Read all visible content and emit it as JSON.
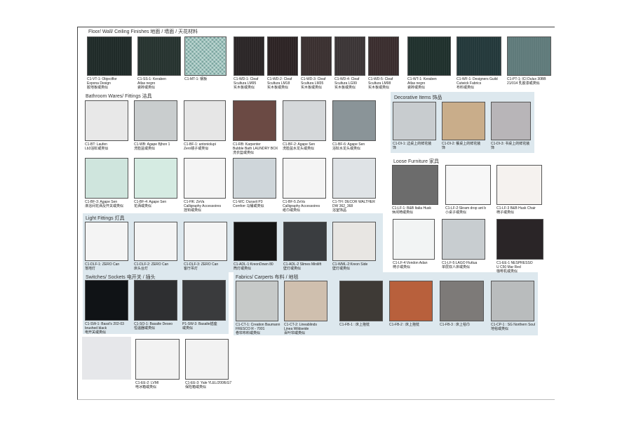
{
  "sections": {
    "finishes": "Floor/ Wall/ Ceiling Finishes 地面 / 墙面 / 天花材料",
    "bathroom": "Bathroom Wares/ Fittings 洁具",
    "decorative": "Decorative Items 饰品",
    "loose": "Loose Furniture 家具",
    "light": "Light Fittings 灯具",
    "switches": "Switches/ Sockets 电开关 / 插头",
    "fabrics": "Fabrics/ Carperts 布料 / 地毯"
  },
  "items": [
    {
      "lines": [
        "C1-VT-1: Objectflor",
        "Expona Design",
        "胶地板或类似"
      ],
      "color": "#1f2a28"
    },
    {
      "lines": [
        "C1-SS-1: Keraben",
        "Atlas negro",
        "瓷砖或类似"
      ],
      "color": "#26332f"
    },
    {
      "lines": [
        "C1-MT-1: 钢板"
      ],
      "color": "#9fc4bd"
    },
    {
      "lines": [
        "C1-WD-1: Cleaf",
        "Scultura LM95",
        "实木板或类似"
      ],
      "color": "#2a2526"
    },
    {
      "lines": [
        "C1-WD-2: Cleaf",
        "Scultura LM18",
        "实木板或类似"
      ],
      "color": "#2c2324"
    },
    {
      "lines": [
        "C1-WD-3: Cleaf",
        "Scultura LM35",
        "实木板或类似"
      ],
      "color": "#3a3030"
    },
    {
      "lines": [
        "C1-WD-4: Cleaf",
        "Scultura LG99",
        "实木板或类似"
      ],
      "color": "#3b3536"
    },
    {
      "lines": [
        "C1-WD-5: Cleaf",
        "Scultura LM98",
        "实木板或类似"
      ],
      "color": "#3a2d2e"
    },
    {
      "lines": [
        "C1-WT-1: Keraben",
        "Atlas negro",
        "瓷砖或类似"
      ],
      "color": "#1f302c"
    },
    {
      "lines": [
        "C1-WF-1: Designers Guild",
        "Cutwick Fabrics",
        "布料或类似"
      ],
      "color": "#23383a"
    },
    {
      "lines": [
        "C1-PT-1: ICI Dulux 30BB",
        "21/014 乳胶漆或类似"
      ],
      "color": "#5f7a7a"
    },
    {
      "lines": [
        "C1-BT: Laufen",
        "Lb3浴缸或类似"
      ],
      "color": "#e8e8e8"
    },
    {
      "lines": [
        "C1-WB: Agape Bjhon 1",
        "洗脸盆或类似"
      ],
      "color": "#c9cdce"
    },
    {
      "lines": [
        "C1-BF-1: antoniolupi",
        "Zero镜子或类似"
      ],
      "color": "#e6e6e6"
    },
    {
      "lines": [
        "C1-RB: Karpenter",
        "Bubble Bath LAUNDRY BOX",
        "洗衣篮或类似"
      ],
      "color": "#6b4a44"
    },
    {
      "lines": [
        "C1-BF-2: Agape Sen",
        "洗脸盆水龙头或类似"
      ],
      "color": "#d5d8da"
    },
    {
      "lines": [
        "C1-BF-6: Agape Sen",
        "浴缸水龙头或类似"
      ],
      "color": "#8a9498"
    },
    {
      "lines": [
        "C1-BF-3: Agape Sen",
        "淋浴间花洒及开关或类似"
      ],
      "color": "#cfe5dd"
    },
    {
      "lines": [
        "C1-BF-4: Agape Sen",
        "花洒或类似"
      ],
      "color": "#d5ebe2"
    },
    {
      "lines": [
        "C1-HK: ZeVa",
        "Calligraphy Accessoires",
        "挂钩或类似"
      ],
      "color": "#f4f4f4"
    },
    {
      "lines": [
        "C1-WC: Duravit P3",
        "Comforr 马桶或类似"
      ],
      "color": "#cfd6da"
    },
    {
      "lines": [
        "C1-BF-5 ZeVa",
        "Calligraphy Accessoires",
        "纸巾或类似"
      ],
      "color": "#f4f4f4"
    },
    {
      "lines": [
        "C1-TH: DECOR WALTHER",
        "DW 362_368",
        "浴室饰品"
      ],
      "color": "#dfe3e6"
    },
    {
      "lines": [
        "C1-DI-1: 边桌上的鲜花装",
        "饰"
      ],
      "color": "#c8cccf"
    },
    {
      "lines": [
        "C1-DI-2: 餐桌上的鲜花装",
        "饰"
      ],
      "color": "#c9ad8a"
    },
    {
      "lines": [
        "C1-DI-3: 书桌上的鲜花装",
        "饰"
      ],
      "color": "#b8b5b8"
    },
    {
      "lines": [
        "C1-LF-1: B&B Italia Husk",
        "休闲椅或类似"
      ],
      "color": "#6c6c6c"
    },
    {
      "lines": [
        "C1-LF-2:Skram drop ant b",
        "小桌子或类似"
      ],
      "color": "#f7f7f7"
    },
    {
      "lines": [
        "C1-LF-3 B&B  Husk Chair",
        "椅子或类似"
      ],
      "color": "#f5f2ef"
    },
    {
      "lines": [
        "C1-LF-4:Vondon  Adan",
        "椅子或类似"
      ],
      "color": "#f2f4f4"
    },
    {
      "lines": [
        "C1-LF-5:LAGO Fluttua",
        "单层双人床或类似"
      ],
      "color": "#c8cdd0"
    },
    {
      "lines": [
        "C1-EE-1 NESPRESSO",
        "U C50 Mar Red",
        "咖啡机或类似"
      ],
      "color": "#2a2527"
    },
    {
      "lines": [
        "C1-DLF-1: ZERO Can",
        "落地灯"
      ],
      "color": "#f4f4f4"
    },
    {
      "lines": [
        "C1-DLF-2: ZERO Can",
        "床头台灯"
      ],
      "color": "#f4f4f4"
    },
    {
      "lines": [
        "C1-DLF-3: ZERO Can",
        "客厅吊灯"
      ],
      "color": "#f4f4f4"
    },
    {
      "lines": [
        "C1-ADL-1:KreonDown 80",
        "筒灯或类似"
      ],
      "color": "#151515"
    },
    {
      "lines": [
        "C1-ADL-2  Slimes Minilift",
        "壁灯或类似"
      ],
      "color": "#3a3d40"
    },
    {
      "lines": [
        "C1-WML-2:Kreon Side",
        "壁灯或类似"
      ],
      "color": "#e8e6e3"
    },
    {
      "lines": [
        "C1-SW-1: Bassl's 202-03",
        "brushed black",
        "电开关或类似"
      ],
      "color": "#101316"
    },
    {
      "lines": [
        "C1-SO-1: Basalte Deseo",
        "恒温器或类似"
      ],
      "color": "#2e2f31"
    },
    {
      "lines": [
        "P1-SW-3: Basalte插座",
        "或类似"
      ],
      "color": "#3a3b3d"
    },
    {
      "lines": [
        "C1-CT-1: Creation Baumann",
        "FRESCO R - 7001",
        "卷帘布料或类似"
      ],
      "color": "#c6c9c8"
    },
    {
      "lines": [
        "C1-CT-2: Lineablinds",
        "Linea Wildseide",
        "百叶帘或类似"
      ],
      "color": "#cfbfae"
    },
    {
      "lines": [
        "C1-FB-1 : 床上抱枕"
      ],
      "color": "#3e3a36"
    },
    {
      "lines": [
        "C1-FB-2 : 床上抱枕"
      ],
      "color": "#b8603c"
    },
    {
      "lines": [
        "C1-FB-3 : 床上毯巾"
      ],
      "color": "#7d7a78"
    },
    {
      "lines": [
        "C1-CP-1 : SG Northern Soul",
        "地毯或类似"
      ],
      "color": "#b9bcbd"
    },
    {
      "lines": [],
      "color": "#e6e7ea"
    },
    {
      "lines": [
        "C1-EE-2: LVMI",
        "电冰箱或类似"
      ],
      "color": "#f2f2f2"
    },
    {
      "lines": [
        "C1-EE-3: Yale YLEL/200/EG7",
        "保险箱或类似"
      ],
      "color": "#f2f2f2"
    }
  ]
}
